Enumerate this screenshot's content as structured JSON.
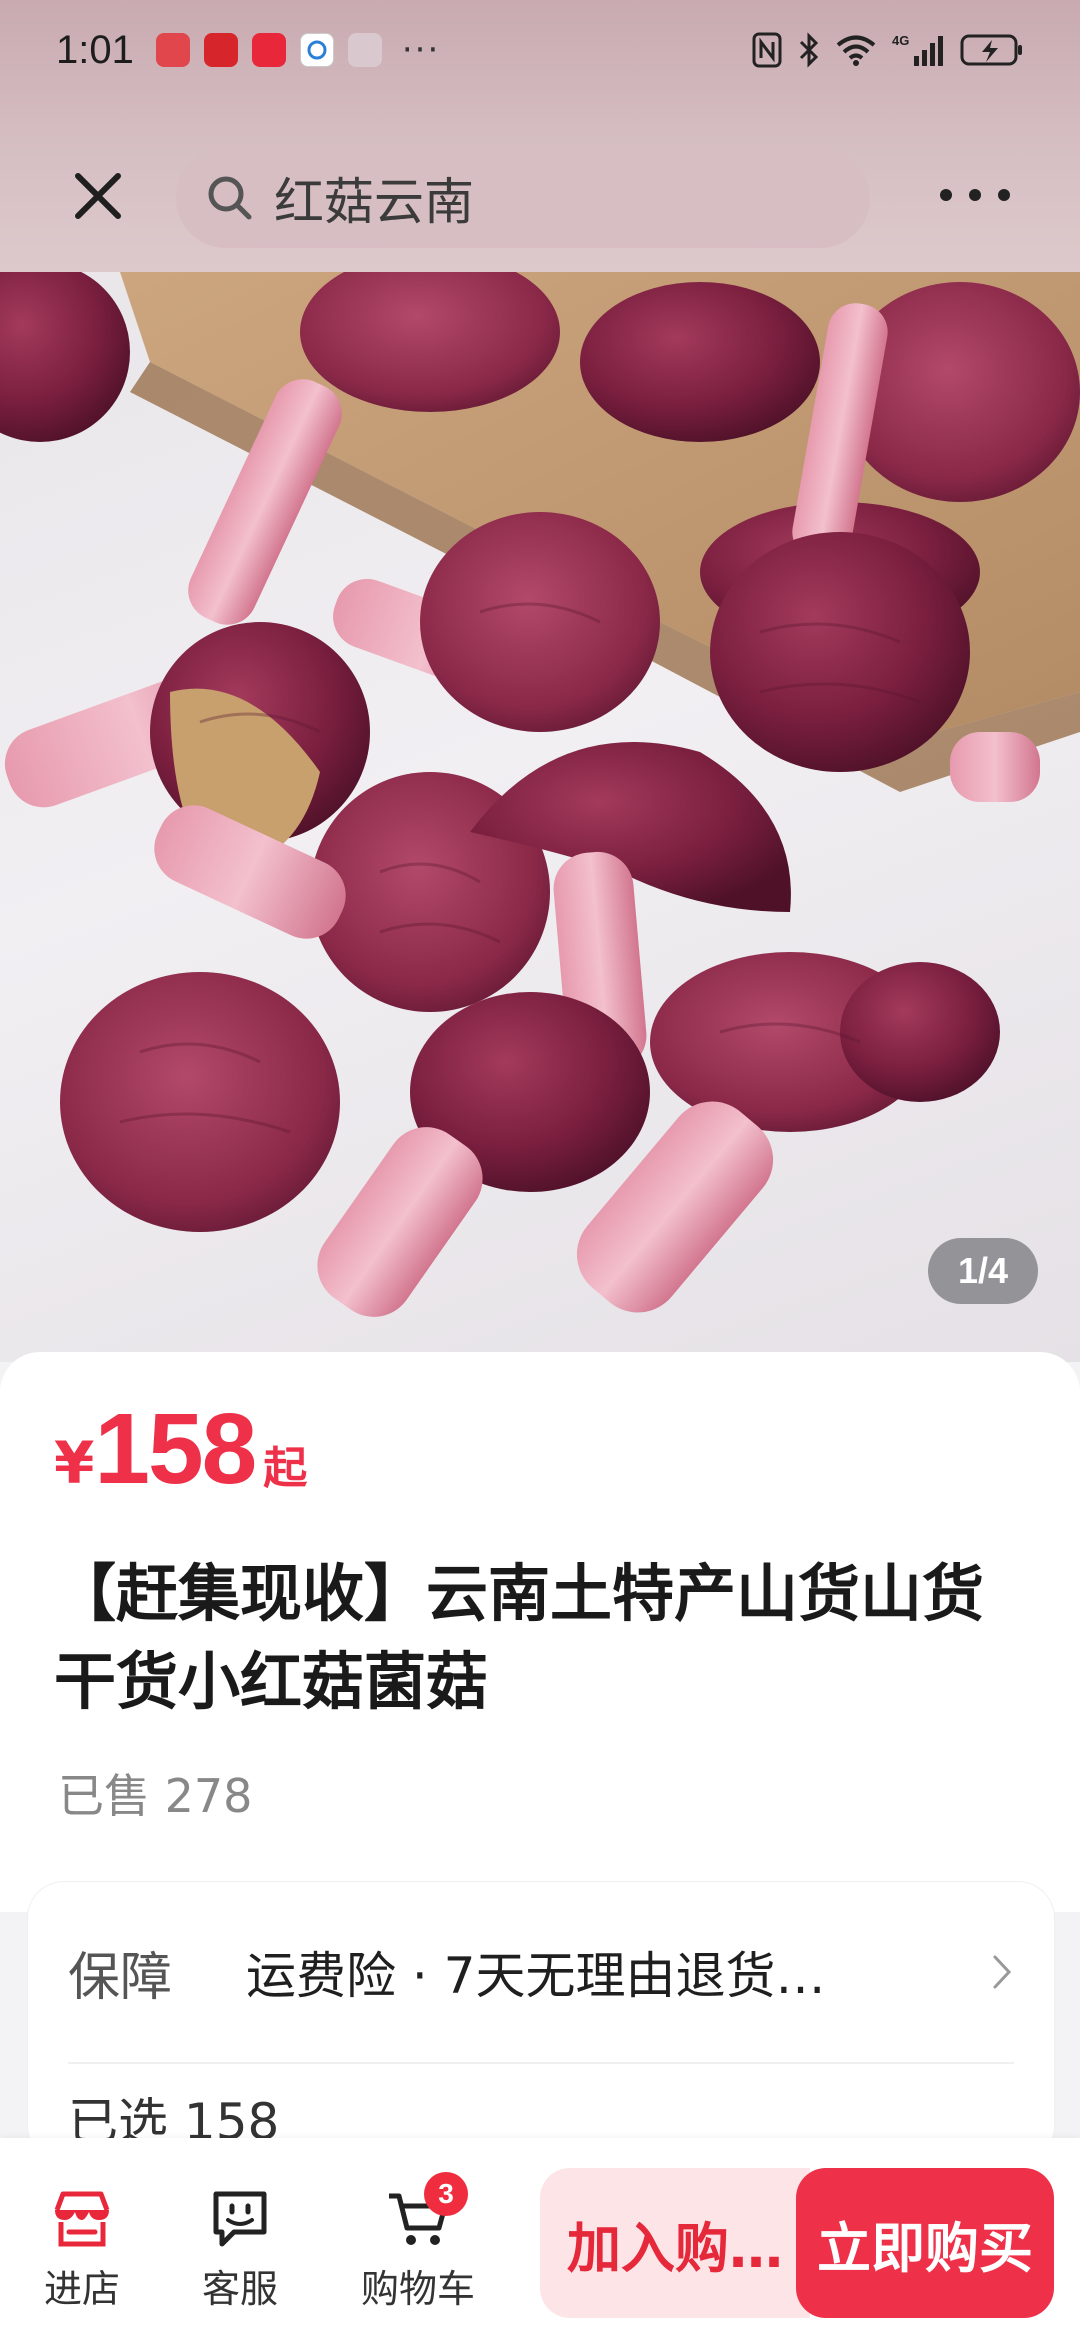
{
  "status_bar": {
    "time": "1:01",
    "more_indicator": "···",
    "network_label": "4G"
  },
  "search": {
    "query": "红菇云南"
  },
  "gallery": {
    "counter": "1/4"
  },
  "product": {
    "currency": "¥",
    "price": "158",
    "price_suffix": "起",
    "title": "【赶集现收】云南土特产山货山货干货小红菇菌菇",
    "sold": "已售 278"
  },
  "guarantee": {
    "label": "保障",
    "value": "运费险 · 7天无理由退货…",
    "next_row_partial": "已选  158"
  },
  "bottom_bar": {
    "shop_label": "进店",
    "service_label": "客服",
    "cart_label": "购物车",
    "cart_count": "3",
    "add_to_cart_label": "加入购…",
    "buy_now_label": "立即购买"
  },
  "colors": {
    "accent": "#ef3049",
    "add_cart_bg": "#fde4e6"
  }
}
